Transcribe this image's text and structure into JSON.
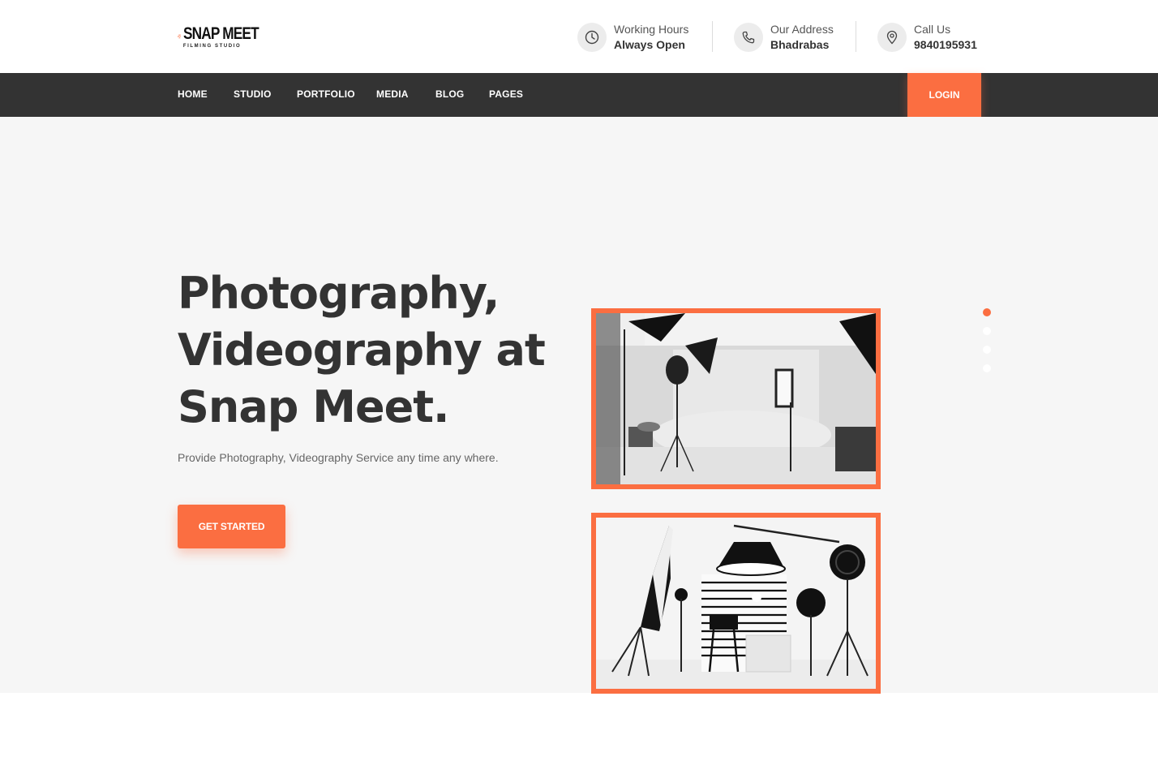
{
  "brand": {
    "name": "SNAP MEET",
    "tagline": "FILMING STUDIO",
    "accent": "#fb6e41",
    "nav_bg": "#333333"
  },
  "header_info": [
    {
      "label": "Working Hours",
      "value": "Always Open",
      "icon": "clock-icon"
    },
    {
      "label": "Our Address",
      "value": "Bhadrabas",
      "icon": "phone-icon"
    },
    {
      "label": "Call Us",
      "value": "9840195931",
      "icon": "location-pin-icon"
    }
  ],
  "nav": {
    "items": [
      "HOME",
      "STUDIO",
      "PORTFOLIO",
      "MEDIA",
      "BLOG",
      "PAGES"
    ],
    "login_label": "LOGIN"
  },
  "hero": {
    "headline_lines": [
      "Photography,",
      "Videography at",
      "Snap Meet."
    ],
    "subtext": "Provide Photography, Videography Service any time any where.",
    "cta_label": "GET STARTED",
    "slider_active_index": 0,
    "slider_count": 4
  }
}
